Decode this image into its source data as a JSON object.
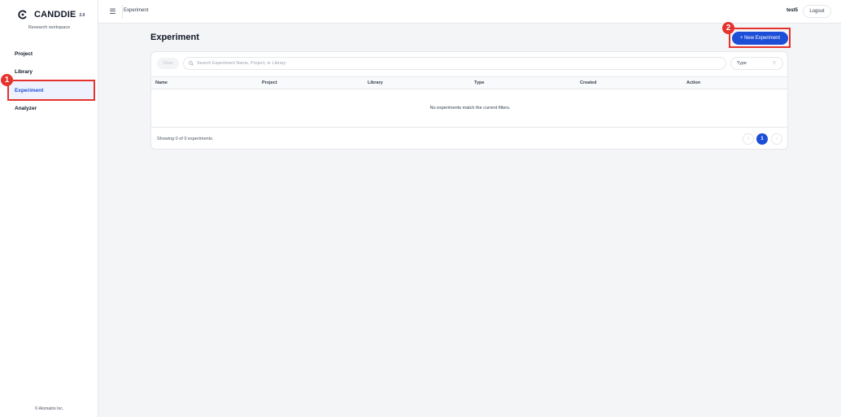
{
  "app": {
    "brand": "CANDDIE",
    "version": "2.0",
    "workspace": "Research workspace",
    "footer": "© Atomatrix Inc."
  },
  "sidebar": {
    "items": [
      {
        "label": "Project",
        "active": false
      },
      {
        "label": "Library",
        "active": false
      },
      {
        "label": "Experiment",
        "active": true
      },
      {
        "label": "Analyzer",
        "active": false
      }
    ]
  },
  "topbar": {
    "breadcrumb": "Experiment",
    "user": "test5",
    "logout_label": "Logout"
  },
  "page": {
    "title": "Experiment",
    "new_button_label": "+ New Experiment"
  },
  "filters": {
    "clear_label": "Clear",
    "search_placeholder": "Search Experiment Name, Project, or Library",
    "search_value": "",
    "type_label": "Type"
  },
  "table": {
    "columns": [
      "Name",
      "Project",
      "Library",
      "Type",
      "Created",
      "Action"
    ],
    "rows": [],
    "empty_message": "No experiments match the current filters."
  },
  "pagination": {
    "summary": "Showing 0 of 0 experiments.",
    "prev_glyph": "‹",
    "current_page": "1",
    "next_glyph": "›"
  },
  "annotations": [
    {
      "number": "1",
      "target": "sidebar Experiment item"
    },
    {
      "number": "2",
      "target": "+ New Experiment button"
    }
  ],
  "colors": {
    "accent": "#1d4ed8",
    "annotation": "#e5322d",
    "background": "#f4f5f7"
  }
}
